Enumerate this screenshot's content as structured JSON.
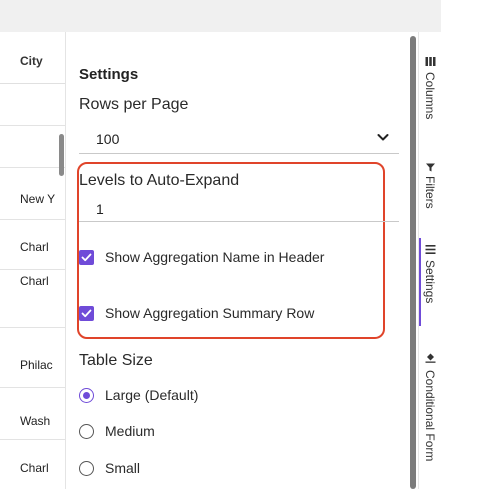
{
  "table": {
    "header": "City",
    "rows": [
      "New Y",
      "Charl",
      "Charl",
      "Philac",
      "Wash",
      "Charl"
    ]
  },
  "settings": {
    "title": "Settings",
    "rows_per_page": {
      "label": "Rows per Page",
      "value": "100"
    },
    "levels_expand": {
      "label": "Levels to Auto-Expand",
      "value": "1"
    },
    "options": [
      {
        "label": "Show Aggregation Name in Header",
        "checked": true
      },
      {
        "label": "Show Aggregation Summary Row",
        "checked": true
      }
    ],
    "table_size": {
      "label": "Table Size",
      "options": [
        "Large (Default)",
        "Medium",
        "Small"
      ],
      "selected": "Large (Default)"
    }
  },
  "side_tabs": [
    "Columns",
    "Filters",
    "Settings",
    "Conditional Form"
  ],
  "colors": {
    "accent": "#6f4bd8",
    "highlight": "#e0442a"
  }
}
